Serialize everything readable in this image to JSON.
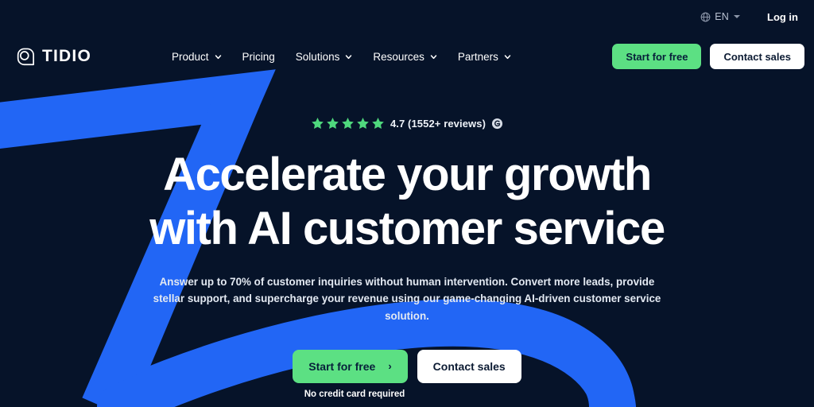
{
  "colors": {
    "background": "#061329",
    "accent_blue": "#2266f5",
    "accent_green": "#5ce083",
    "star_green": "#4fd87d",
    "text_primary": "#ffffff",
    "text_muted": "#b9c2d2",
    "button_dark_text": "#07203a"
  },
  "utility_bar": {
    "globe_icon": "globe-icon",
    "language": "EN",
    "caret_icon": "chevron-down-icon",
    "login_label": "Log in"
  },
  "brand": {
    "logo_icon": "tidio-speech-bubble-logo",
    "name": "TIDIO"
  },
  "nav": {
    "items": [
      {
        "label": "Product",
        "has_dropdown": true
      },
      {
        "label": "Pricing",
        "has_dropdown": false
      },
      {
        "label": "Solutions",
        "has_dropdown": true
      },
      {
        "label": "Resources",
        "has_dropdown": true
      },
      {
        "label": "Partners",
        "has_dropdown": true
      }
    ],
    "start_free_label": "Start for free",
    "contact_sales_label": "Contact sales"
  },
  "hero": {
    "rating": {
      "stars_filled": 5,
      "stars_total": 5,
      "score": "4.7",
      "reviews_text": "4.7 (1552+ reviews)",
      "badge_icon": "g2-review-badge-icon"
    },
    "headline_line1": "Accelerate your growth",
    "headline_line2": "with AI customer service",
    "subheading": "Answer up to 70% of customer inquiries without human intervention. Convert more leads, provide stellar support, and supercharge your revenue using our game-changing AI-driven customer service solution.",
    "cta_primary_label": "Start for free",
    "cta_primary_arrow": "›",
    "cta_secondary_label": "Contact sales",
    "credit_note": "No credit card required"
  }
}
